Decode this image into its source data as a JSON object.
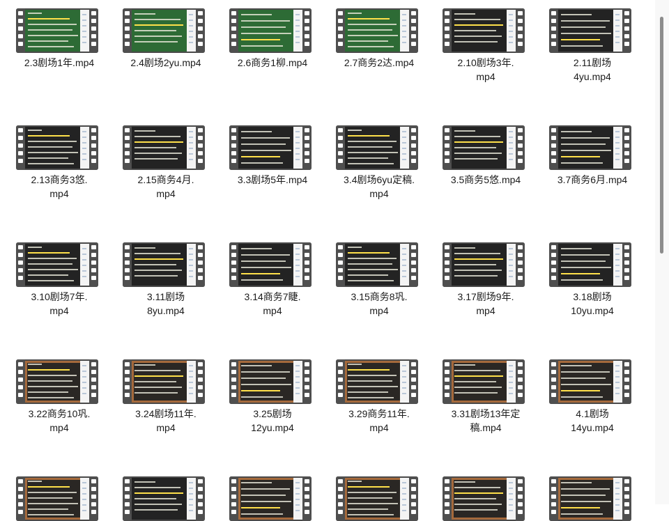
{
  "files": [
    {
      "name": "2.3剧场1年.mp4",
      "theme": "green"
    },
    {
      "name": "2.4剧场2yu.mp4",
      "theme": "green"
    },
    {
      "name": "2.6商务1柳.mp4",
      "theme": "green"
    },
    {
      "name": "2.7商务2达.mp4",
      "theme": "green"
    },
    {
      "name": "2.10剧场3年.mp4",
      "theme": "dark"
    },
    {
      "name": "2.11剧场4yu.mp4",
      "theme": "dark"
    },
    {
      "name": "2.13商务3悠.mp4",
      "theme": "dark"
    },
    {
      "name": "2.15商务4月.mp4",
      "theme": "dark"
    },
    {
      "name": "3.3剧场5年.mp4",
      "theme": "dark"
    },
    {
      "name": "3.4剧场6yu定稿.mp4",
      "theme": "dark"
    },
    {
      "name": "3.5商务5悠.mp4",
      "theme": "dark"
    },
    {
      "name": "3.7商务6月.mp4",
      "theme": "dark"
    },
    {
      "name": "3.10剧场7年.mp4",
      "theme": "dark"
    },
    {
      "name": "3.11剧场8yu.mp4",
      "theme": "dark"
    },
    {
      "name": "3.14商务7睫.mp4",
      "theme": "dark"
    },
    {
      "name": "3.15商务8巩.mp4",
      "theme": "dark"
    },
    {
      "name": "3.17剧场9年.mp4",
      "theme": "dark"
    },
    {
      "name": "3.18剧场10yu.mp4",
      "theme": "dark"
    },
    {
      "name": "3.22商务10巩.mp4",
      "theme": "board"
    },
    {
      "name": "3.24剧场11年.mp4",
      "theme": "board"
    },
    {
      "name": "3.25剧场12yu.mp4",
      "theme": "board"
    },
    {
      "name": "3.29商务11年.mp4",
      "theme": "board"
    },
    {
      "name": "3.31剧场13年定稿.mp4",
      "theme": "board"
    },
    {
      "name": "4.1剧场14yu.mp4",
      "theme": "board"
    },
    {
      "name": "",
      "theme": "board"
    },
    {
      "name": "",
      "theme": "dark"
    },
    {
      "name": "",
      "theme": "board"
    },
    {
      "name": "",
      "theme": "board"
    },
    {
      "name": "",
      "theme": "board"
    },
    {
      "name": "",
      "theme": "board"
    }
  ],
  "labels": [
    [
      "2.3剧场1年.mp4"
    ],
    [
      "2.4剧场2yu.mp4"
    ],
    [
      "2.6商务1柳.mp4"
    ],
    [
      "2.7商务2达.mp4"
    ],
    [
      "2.10剧场3年.",
      "mp4"
    ],
    [
      "2.11剧场",
      "4yu.mp4"
    ],
    [
      "2.13商务3悠.",
      "mp4"
    ],
    [
      "2.15商务4月.",
      "mp4"
    ],
    [
      "3.3剧场5年.mp4"
    ],
    [
      "3.4剧场6yu定稿.",
      "mp4"
    ],
    [
      "3.5商务5悠.mp4"
    ],
    [
      "3.7商务6月.mp4"
    ],
    [
      "3.10剧场7年.",
      "mp4"
    ],
    [
      "3.11剧场",
      "8yu.mp4"
    ],
    [
      "3.14商务7睫.",
      "mp4"
    ],
    [
      "3.15商务8巩.",
      "mp4"
    ],
    [
      "3.17剧场9年.",
      "mp4"
    ],
    [
      "3.18剧场",
      "10yu.mp4"
    ],
    [
      "3.22商务10巩.",
      "mp4"
    ],
    [
      "3.24剧场11年.",
      "mp4"
    ],
    [
      "3.25剧场",
      "12yu.mp4"
    ],
    [
      "3.29商务11年.",
      "mp4"
    ],
    [
      "3.31剧场13年定",
      "稿.mp4"
    ],
    [
      "4.1剧场",
      "14yu.mp4"
    ]
  ],
  "themes": {
    "green": "#2d6b35",
    "dark": "#232323",
    "board": "#2a2724",
    "board_frame": "#a56a3c"
  },
  "film_icon": "film-strip-icon"
}
